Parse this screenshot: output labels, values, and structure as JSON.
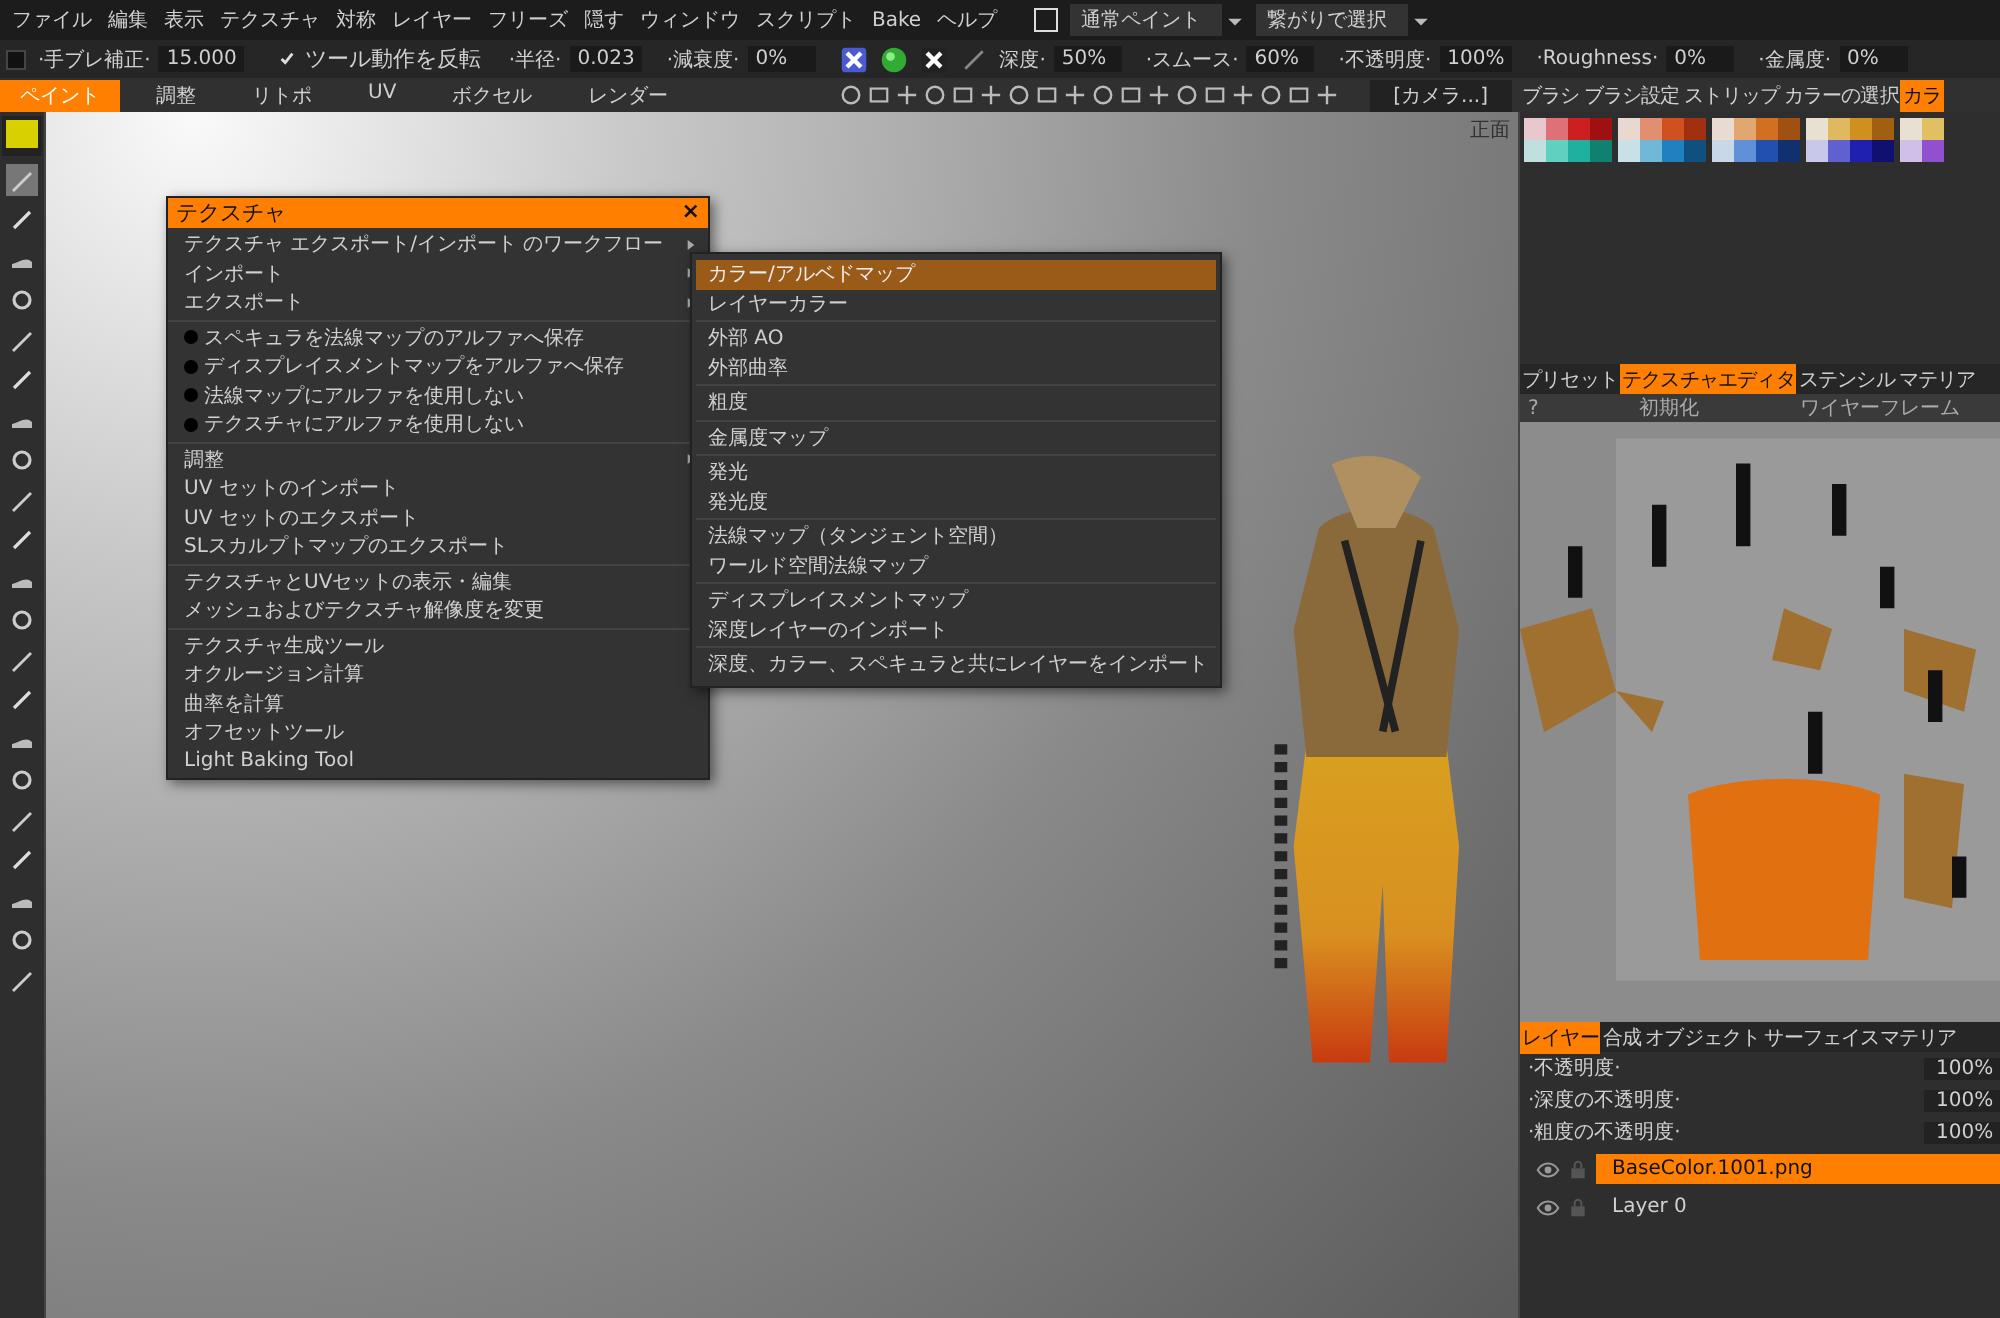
{
  "menu_bar": {
    "items": [
      "ファイル",
      "編集",
      "表示",
      "テクスチャ",
      "対称",
      "レイヤー",
      "フリーズ",
      "隠す",
      "ウィンドウ",
      "スクリプト",
      "Bake",
      "ヘルプ"
    ],
    "paint_mode_checkbox": {
      "checked": false
    },
    "paint_mode": "通常ペイント",
    "select_mode": "繋がりで選択"
  },
  "tool_options": [
    {
      "kind": "field",
      "label": "·手ブレ補正·",
      "value": "15.000",
      "checked": false
    },
    {
      "kind": "check",
      "label": "ツール動作を反転",
      "checked": true
    },
    {
      "kind": "field",
      "label": "·半径·",
      "value": "0.023"
    },
    {
      "kind": "field",
      "label": "·減衰度·",
      "value": "0%"
    },
    {
      "kind": "icons"
    },
    {
      "kind": "field",
      "label": "深度·",
      "value": "50%"
    },
    {
      "kind": "field",
      "label": "·スムース·",
      "value": "60%"
    },
    {
      "kind": "field",
      "label": "·不透明度·",
      "value": "100%"
    },
    {
      "kind": "field",
      "label": "·Roughness·",
      "value": "0%"
    },
    {
      "kind": "field",
      "label": "·金属度·",
      "value": "0%"
    }
  ],
  "rooms": [
    {
      "label": "ペイント",
      "selected": true
    },
    {
      "label": "調整",
      "selected": false
    },
    {
      "label": "リトポ",
      "selected": false
    },
    {
      "label": "UV",
      "selected": false
    },
    {
      "label": "ボクセル",
      "selected": false
    },
    {
      "label": "レンダー",
      "selected": false
    }
  ],
  "camera": "[カメラ...]",
  "panel_tabs": [
    {
      "label": "ブラシ",
      "selected": false
    },
    {
      "label": "ブラシ設定",
      "selected": false
    },
    {
      "label": "ストリップ",
      "selected": false
    },
    {
      "label": "カラーの選択",
      "selected": false
    },
    {
      "label": "カラ",
      "selected": true
    }
  ],
  "viewport": {
    "view_label": "正面"
  },
  "texture_menu": {
    "title": "テクスチャ",
    "close": "×",
    "groups": [
      [
        {
          "kind": "submenu",
          "label": "テクスチャ エクスポート/インポート のワークフロー"
        },
        {
          "kind": "submenu",
          "label": "インポート"
        },
        {
          "kind": "submenu",
          "label": "エクスポート"
        }
      ],
      [
        {
          "kind": "bullet",
          "label": "スペキュラを法線マップのアルファへ保存"
        },
        {
          "kind": "bullet",
          "label": "ディスプレイスメントマップをアルファへ保存"
        },
        {
          "kind": "bullet",
          "label": "法線マップにアルファを使用しない"
        },
        {
          "kind": "bullet",
          "label": "テクスチャにアルファを使用しない"
        }
      ],
      [
        {
          "kind": "submenu",
          "label": "調整"
        },
        {
          "kind": "item",
          "label": "UV セットのインポート"
        },
        {
          "kind": "item",
          "label": "UV セットのエクスポート"
        },
        {
          "kind": "item",
          "label": "SLスカルプトマップのエクスポート"
        }
      ],
      [
        {
          "kind": "item",
          "label": "テクスチャとUVセットの表示・編集"
        },
        {
          "kind": "item",
          "label": "メッシュおよびテクスチャ解像度を変更"
        }
      ],
      [
        {
          "kind": "item",
          "label": "テクスチャ生成ツール"
        },
        {
          "kind": "item",
          "label": "オクルージョン計算"
        },
        {
          "kind": "item",
          "label": "曲率を計算"
        },
        {
          "kind": "item",
          "label": "オフセットツール"
        },
        {
          "kind": "item",
          "label": "Light Baking Tool"
        }
      ]
    ]
  },
  "import_submenu": {
    "groups": [
      [
        {
          "label": "カラー/アルベドマップ",
          "selected": true
        },
        {
          "label": "レイヤーカラー",
          "selected": false
        }
      ],
      [
        {
          "label": "外部 AO",
          "selected": false
        },
        {
          "label": "外部曲率",
          "selected": false
        }
      ],
      [
        {
          "label": "粗度",
          "selected": false
        }
      ],
      [
        {
          "label": "金属度マップ",
          "selected": false
        }
      ],
      [
        {
          "label": "発光",
          "selected": false
        },
        {
          "label": "発光度",
          "selected": false
        }
      ],
      [
        {
          "label": "法線マップ（タンジェント空間）",
          "selected": false
        },
        {
          "label": "ワールド空間法線マップ",
          "selected": false
        }
      ],
      [
        {
          "label": "ディスプレイスメントマップ",
          "selected": false
        },
        {
          "label": "深度レイヤーのインポート",
          "selected": false
        }
      ],
      [
        {
          "label": "深度、カラー、スペキュラと共にレイヤーをインポート",
          "selected": false
        }
      ]
    ]
  },
  "swatches": [
    [
      {
        "color": "#e8c8cc"
      },
      {
        "color": "#e07078"
      },
      {
        "color": "#cc2020"
      },
      {
        "color": "#a01010"
      },
      {
        "color": "#e8d8d0"
      },
      {
        "color": "#e09070"
      },
      {
        "color": "#d05020"
      },
      {
        "color": "#a03010"
      },
      {
        "color": "#e8dcd0"
      },
      {
        "color": "#e0a870"
      },
      {
        "color": "#d07020"
      },
      {
        "color": "#a05010"
      },
      {
        "color": "#e8e0d0"
      },
      {
        "color": "#e0b860"
      },
      {
        "color": "#d09020"
      },
      {
        "color": "#a06010"
      },
      {
        "color": "#e8e0d0"
      },
      {
        "color": "#e0c060"
      }
    ],
    [
      {
        "color": "#c0e0e0"
      },
      {
        "color": "#60d0c0"
      },
      {
        "color": "#20b0a0"
      },
      {
        "color": "#108070"
      },
      {
        "color": "#c8e0e8"
      },
      {
        "color": "#70b8d8"
      },
      {
        "color": "#2080c0"
      },
      {
        "color": "#105080"
      },
      {
        "color": "#c8d8e8"
      },
      {
        "color": "#6090d8"
      },
      {
        "color": "#2050b0"
      },
      {
        "color": "#103070"
      },
      {
        "color": "#c8c8e8"
      },
      {
        "color": "#6060d0"
      },
      {
        "color": "#2020b0"
      },
      {
        "color": "#101070"
      },
      {
        "color": "#d0c0e8"
      },
      {
        "color": "#9050d0"
      }
    ]
  ],
  "texture_editor": {
    "tabs": [
      {
        "label": "プリセット",
        "selected": false
      },
      {
        "label": "テクスチャエディタ",
        "selected": true
      },
      {
        "label": "ステンシル",
        "selected": false
      },
      {
        "label": "マテリア",
        "selected": false
      }
    ],
    "toolbar": [
      "?",
      "初期化",
      "ワイヤーフレーム"
    ]
  },
  "layers": {
    "tabs": [
      {
        "label": "レイヤー",
        "selected": true
      },
      {
        "label": "合成",
        "selected": false
      },
      {
        "label": "オブジェクト",
        "selected": false
      },
      {
        "label": "サーフェイスマテリア",
        "selected": false
      }
    ],
    "sliders": [
      {
        "label": "·不透明度·",
        "value": "100%"
      },
      {
        "label": "·深度の不透明度·",
        "value": "100%"
      },
      {
        "label": "·粗度の不透明度·",
        "value": "100%"
      }
    ],
    "items": [
      {
        "name": "BaseColor.1001.png",
        "selected": true
      },
      {
        "name": "Layer 0",
        "selected": false
      }
    ]
  }
}
